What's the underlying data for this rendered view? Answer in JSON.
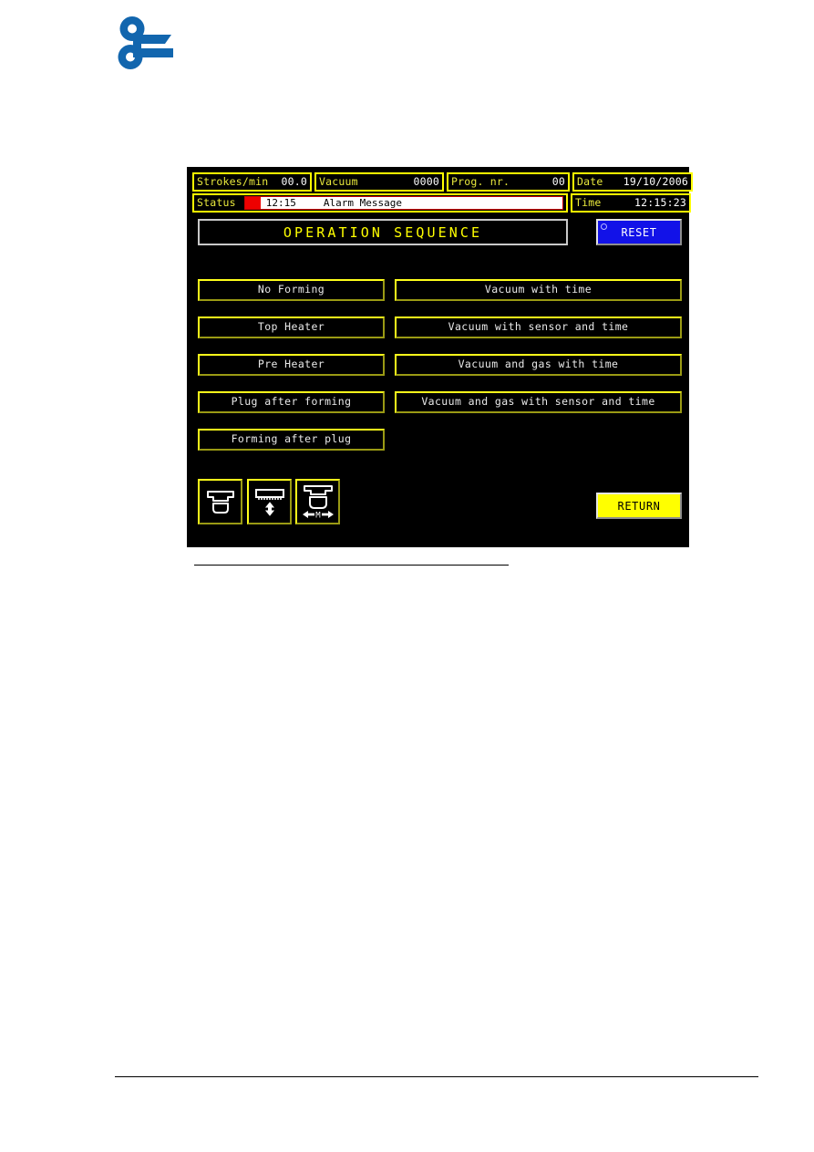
{
  "page": {
    "logo": {
      "name": "company-logo",
      "color": "#1266ae"
    }
  },
  "hmi": {
    "background": "#000000",
    "accent_yellow": "#ffff00",
    "accent_blue": "#1212e8",
    "alarm_red": "#ee0000",
    "status_fields": [
      {
        "label": "Strokes/min",
        "value": "00.0"
      },
      {
        "label": "Vacuum",
        "value": "0000"
      },
      {
        "label": "Prog. nr.",
        "value": "00"
      },
      {
        "label": "Date",
        "value": "19/10/2006"
      }
    ],
    "status_row": {
      "label": "Status",
      "alarm_time": "12:15",
      "alarm_text": "Alarm Message",
      "time_label": "Time",
      "time_value": "12:15:23"
    },
    "title": "OPERATION  SEQUENCE",
    "reset_button": "RESET",
    "return_button": "RETURN",
    "left_column": [
      "No Forming",
      "Top Heater",
      "Pre Heater",
      "Plug after forming",
      "Forming after plug"
    ],
    "right_column": [
      "Vacuum with time",
      "Vacuum with sensor and time",
      "Vacuum and gas with time",
      "Vacuum and gas with sensor and time"
    ],
    "icon_buttons": [
      {
        "icon": "mold-forming-icon",
        "tooltip": "Forming mould"
      },
      {
        "icon": "heater-vertical-arrow-icon",
        "tooltip": "Heater stroke"
      },
      {
        "icon": "mold-horizontal-arrow-icon",
        "tooltip": "Mould movement M"
      }
    ]
  }
}
